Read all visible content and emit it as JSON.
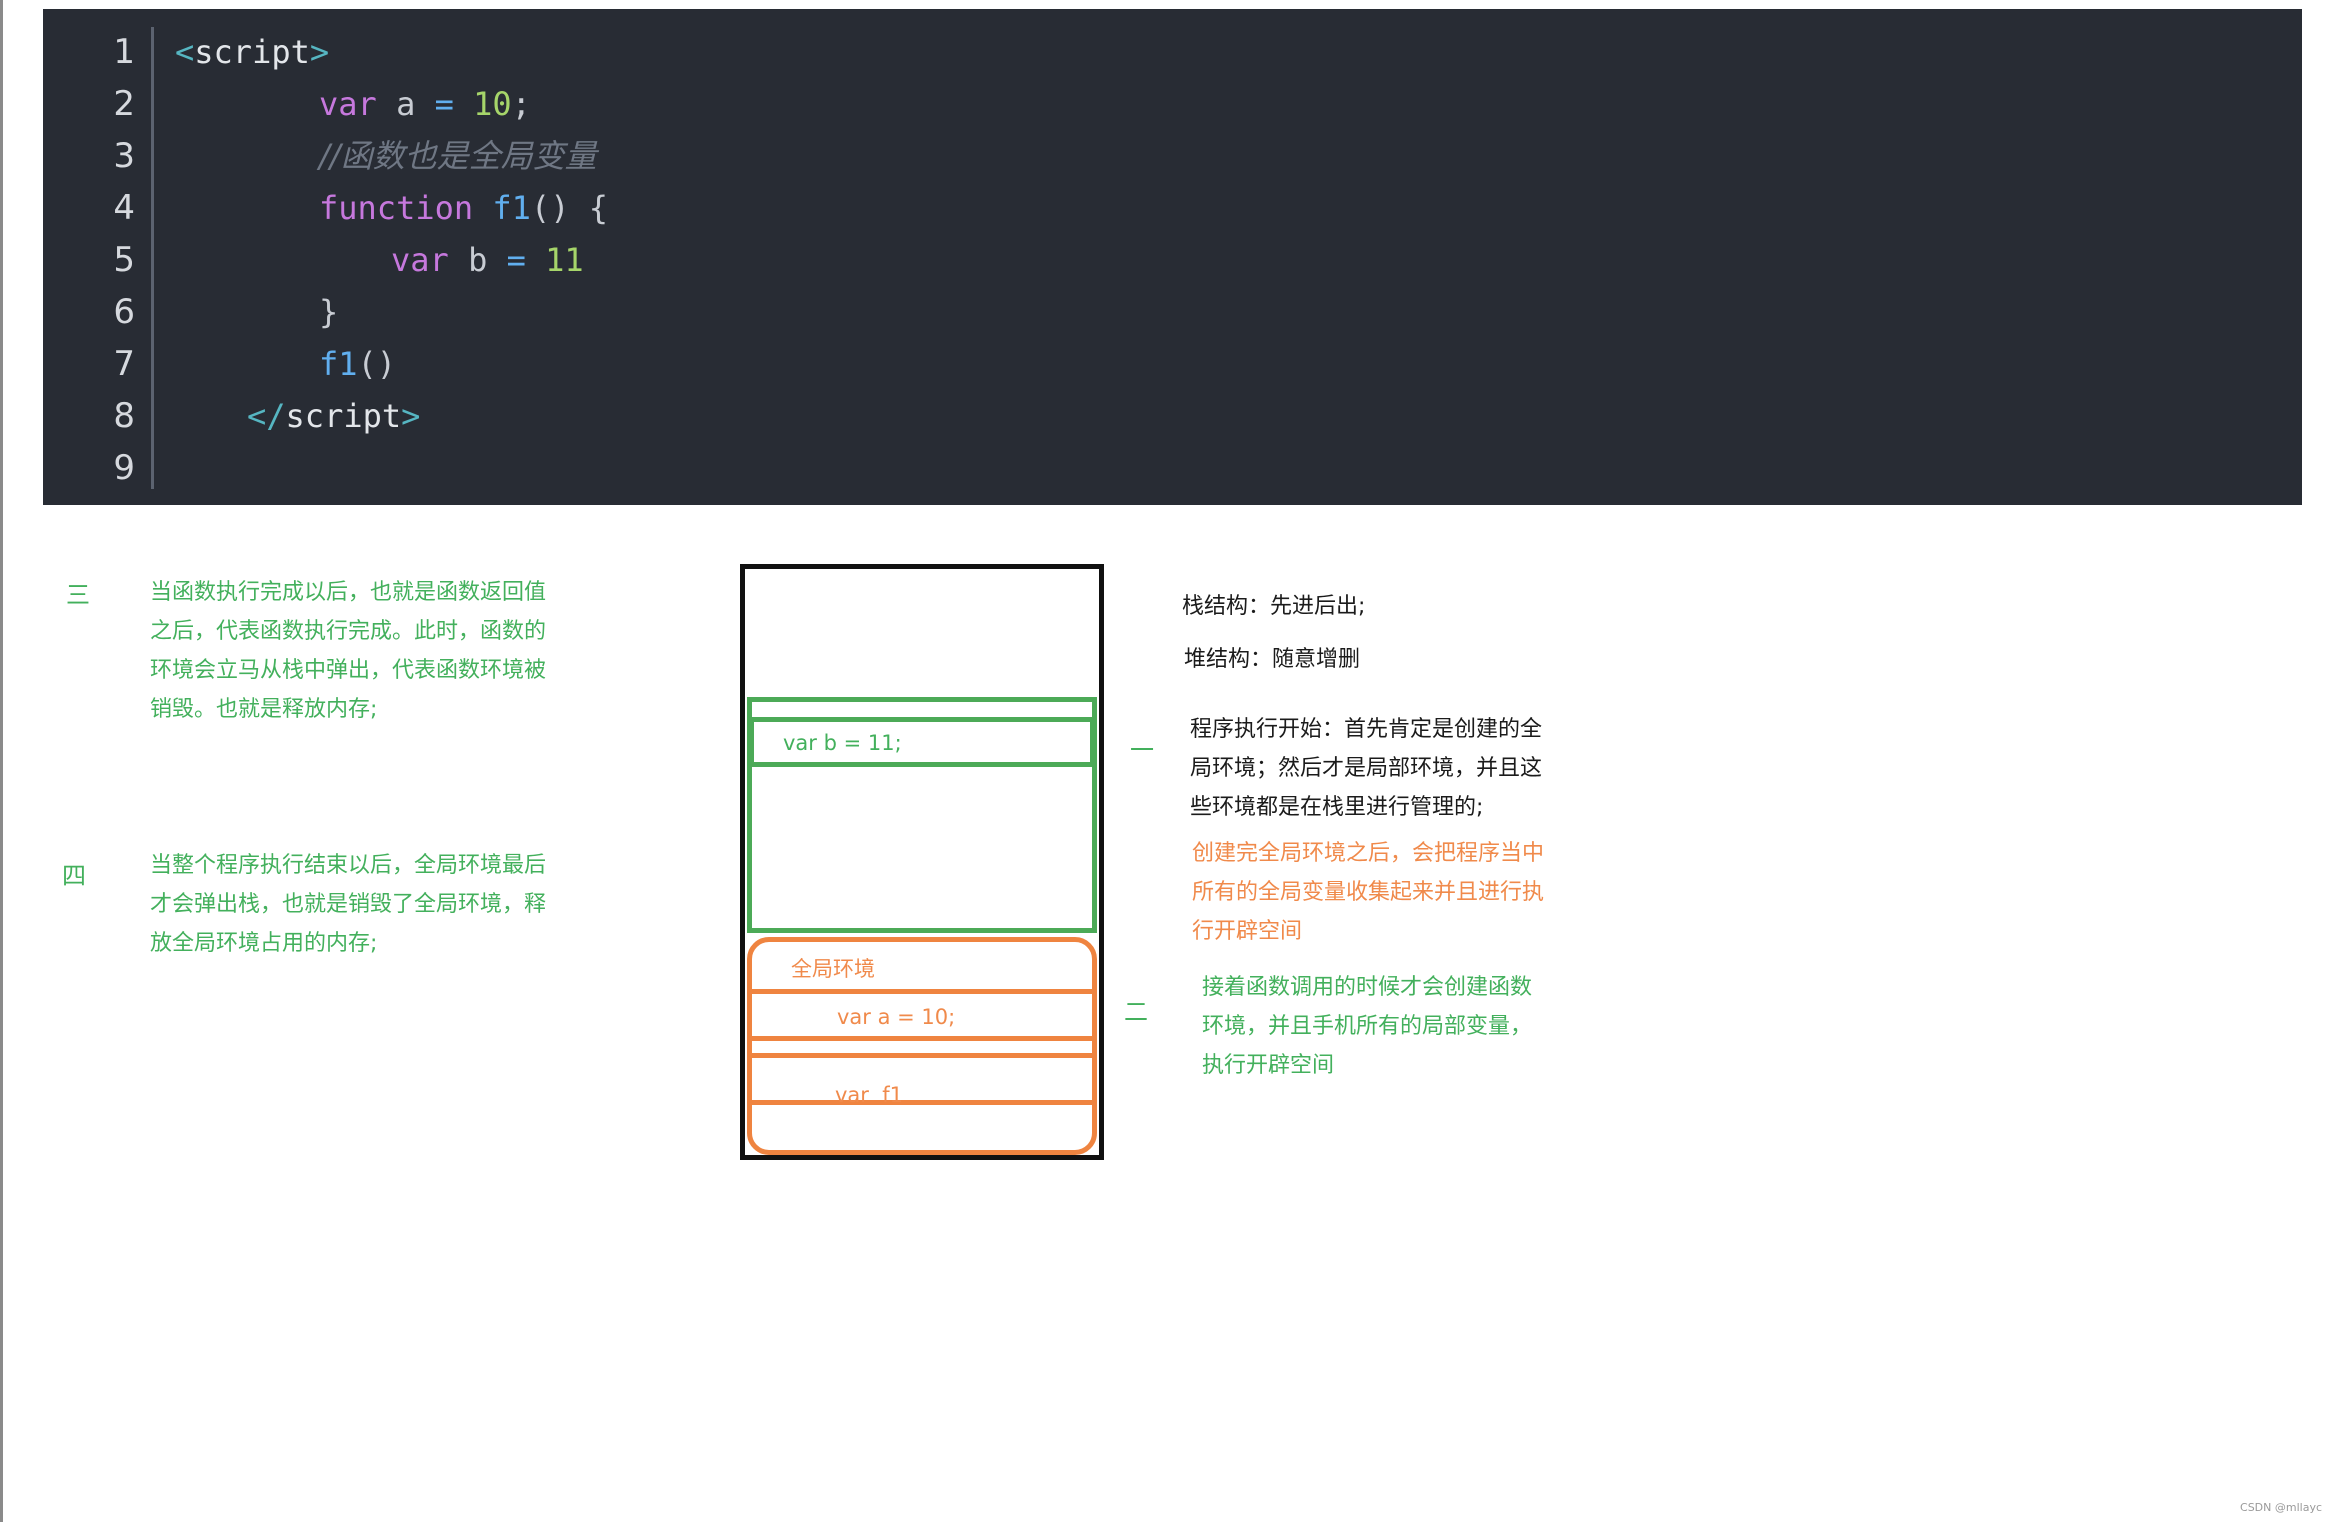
{
  "code": {
    "line_numbers": [
      "1",
      "2",
      "3",
      "4",
      "5",
      "6",
      "7",
      "8",
      "9"
    ],
    "lines": [
      {
        "t1": "<",
        "t2": "script",
        "t3": ">"
      },
      {
        "kw": "var",
        "rest": " a ",
        "op": "=",
        "num": " 10",
        "end": ";"
      },
      {
        "comment": "//函数也是全局变量"
      },
      {
        "kw": "function",
        "fn": " f1",
        "rest": "() {"
      },
      {
        "kw": "var",
        "rest": " b ",
        "op": "=",
        "num": " 11"
      },
      {
        "rest": "}"
      },
      {
        "fn": "f1",
        "rest": "()"
      },
      {
        "t1": "</",
        "t2": "script",
        "t3": ">"
      },
      {}
    ]
  },
  "notes": {
    "three_marker": "三",
    "three_text": [
      "当函数执行完成以后，也就是函数返回值",
      "之后，代表函数执行完成。此时，函数的",
      "环境会立马从栈中弹出，代表函数环境被",
      "销毁。也就是释放内存;"
    ],
    "four_marker": "四",
    "four_text": [
      "当整个程序执行结束以后，全局环境最后",
      "才会弹出栈，也就是销毁了全局环境，释",
      "放全局环境占用的内存;"
    ],
    "stack_def": "栈结构：先进后出;",
    "heap_def": "堆结构：随意增删",
    "one_marker": "一",
    "one_text": [
      "程序执行开始：首先肯定是创建的全",
      "局环境；然后才是局部环境，并且这",
      "些环境都是在栈里进行管理的;"
    ],
    "one_orange_text": [
      "创建完全局环境之后，会把程序当中",
      "所有的全局变量收集起来并且进行执",
      "行开辟空间"
    ],
    "two_marker": "二",
    "two_text": [
      "接着函数调用的时候才会创建函数",
      "环境，并且手机所有的局部变量，",
      "执行开辟空间"
    ]
  },
  "diagram": {
    "func_var": "var b = 11;",
    "global_label": "全局环境",
    "global_var_a": "var a = 10;",
    "global_var_f1": "var  f1"
  },
  "credit": "CSDN @mllayc",
  "colors": {
    "editor_bg": "#282c34",
    "function_env": "#4caa57",
    "global_env": "#ef8440"
  }
}
